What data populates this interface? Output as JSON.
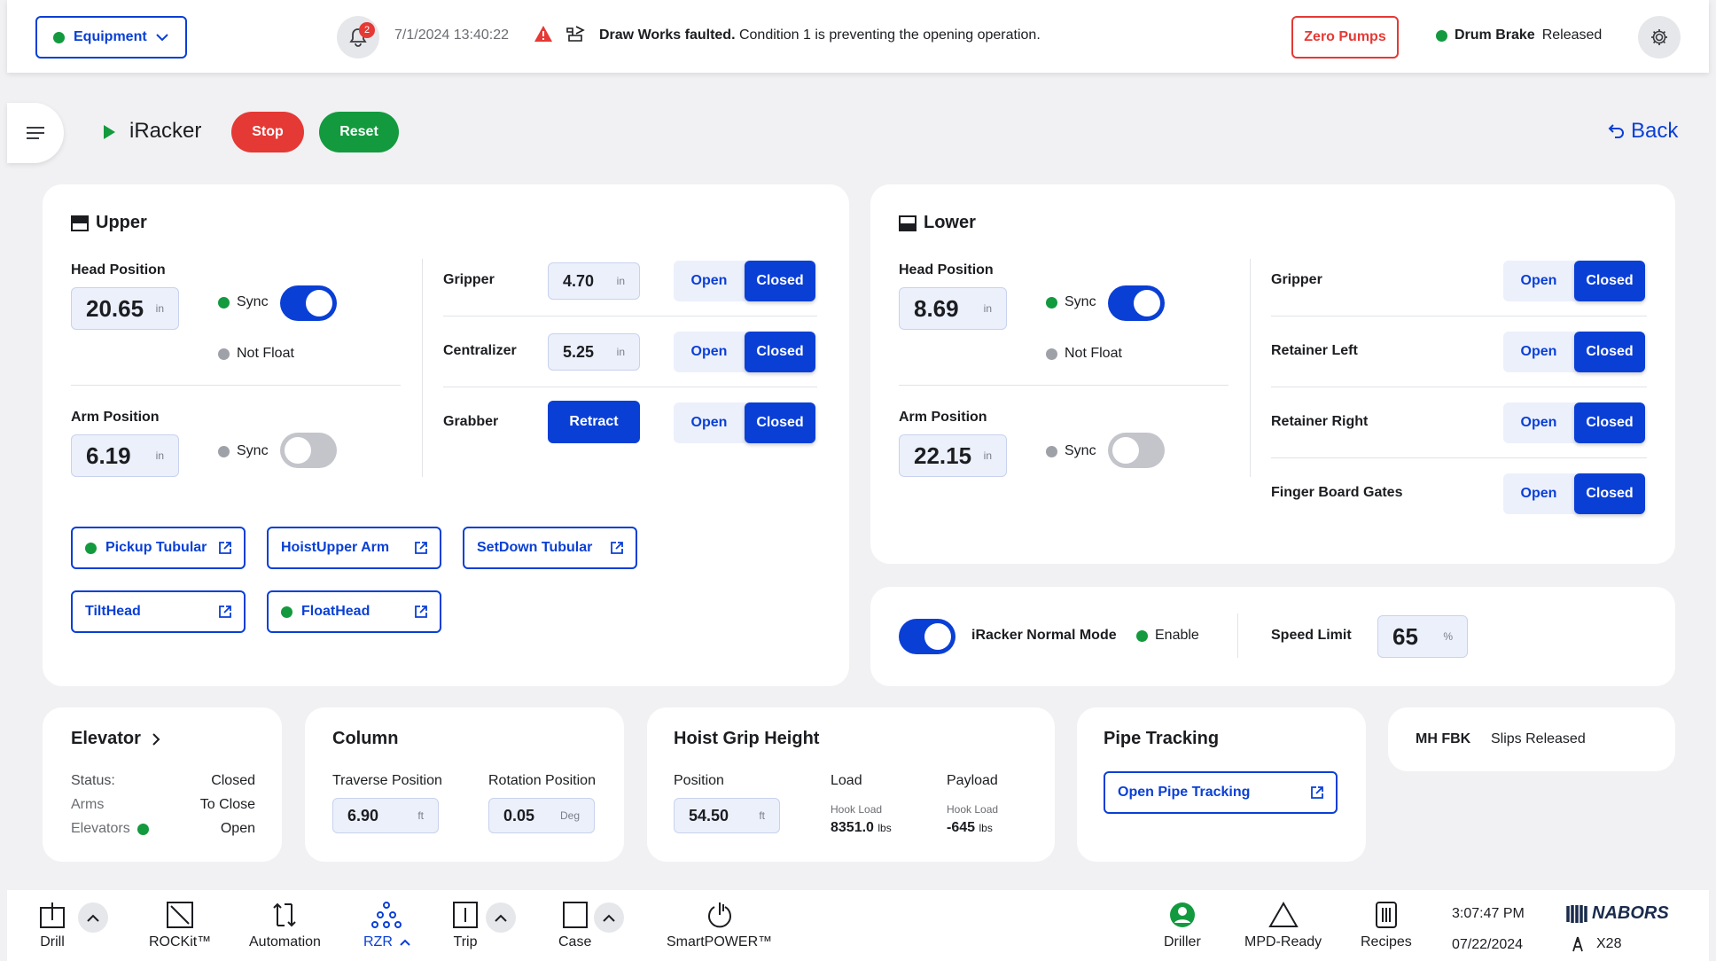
{
  "topbar": {
    "equipment_label": "Equipment",
    "notifications_count": "2",
    "timestamp": "7/1/2024  13:40:22",
    "fault_bold": "Draw Works faulted.",
    "fault_text": " Condition 1 is preventing the opening operation.",
    "zero_pumps_label": "Zero Pumps",
    "drum_brake_label": "Drum Brake",
    "drum_brake_value": "Released"
  },
  "header": {
    "app_title": "iRacker",
    "stop_label": "Stop",
    "reset_label": "Reset",
    "back_label": "Back"
  },
  "upper": {
    "title": "Upper",
    "head_position_label": "Head Position",
    "head_position_value": "20.65",
    "head_position_unit": "in",
    "head_sync_label": "Sync",
    "not_float_label": "Not Float",
    "arm_position_label": "Arm Position",
    "arm_position_value": "6.19",
    "arm_position_unit": "in",
    "arm_sync_label": "Sync",
    "gripper_label": "Gripper",
    "gripper_value": "4.70",
    "gripper_unit": "in",
    "centralizer_label": "Centralizer",
    "centralizer_value": "5.25",
    "centralizer_unit": "in",
    "grabber_label": "Grabber",
    "retract_label": "Retract",
    "open_label": "Open",
    "closed_label": "Closed",
    "buttons": {
      "pickup_tubular": "Pickup Tubular",
      "hoist_upper_arm": "HoistUpper Arm",
      "setdown_tubular": "SetDown Tubular",
      "tilt_head": "TiltHead",
      "float_head": "FloatHead"
    }
  },
  "lower": {
    "title": "Lower",
    "head_position_label": "Head Position",
    "head_position_value": "8.69",
    "head_position_unit": "in",
    "head_sync_label": "Sync",
    "not_float_label": "Not Float",
    "arm_position_label": "Arm Position",
    "arm_position_value": "22.15",
    "arm_position_unit": "in",
    "arm_sync_label": "Sync",
    "gripper_label": "Gripper",
    "retainer_left_label": "Retainer Left",
    "retainer_right_label": "Retainer Right",
    "finger_board_label": "Finger Board Gates",
    "open_label": "Open",
    "closed_label": "Closed"
  },
  "mode": {
    "normal_mode_label": "iRacker Normal Mode",
    "enable_label": "Enable",
    "speed_limit_label": "Speed Limit",
    "speed_limit_value": "65",
    "speed_limit_unit": "%"
  },
  "elevator": {
    "title": "Elevator",
    "status_label": "Status:",
    "status_value": "Closed",
    "arms_label": "Arms",
    "arms_value": "To Close",
    "elevators_label": "Elevators",
    "elevators_value": "Open"
  },
  "column": {
    "title": "Column",
    "traverse_label": "Traverse Position",
    "traverse_value": "6.90",
    "traverse_unit": "ft",
    "rotation_label": "Rotation Position",
    "rotation_value": "0.05",
    "rotation_unit": "Deg"
  },
  "hoist": {
    "title": "Hoist Grip Height",
    "position_label": "Position",
    "position_value": "54.50",
    "position_unit": "ft",
    "load_label": "Load",
    "hook_load_label": "Hook Load",
    "load_value": "8351.0",
    "load_unit": "lbs",
    "payload_label": "Payload",
    "payload_hook_label": "Hook Load",
    "payload_value": "-645",
    "payload_unit": "lbs"
  },
  "pipe_tracking": {
    "title": "Pipe Tracking",
    "open_button": "Open Pipe Tracking"
  },
  "mh": {
    "label": "MH FBK",
    "value": "Slips Released"
  },
  "taskbar": {
    "drill": "Drill",
    "rockit": "ROCKit™",
    "automation": "Automation",
    "rzr": "RZR",
    "trip": "Trip",
    "case": "Case",
    "smartpower": "SmartPOWER™",
    "driller": "Driller",
    "mpd_ready": "MPD-Ready",
    "recipes": "Recipes",
    "time": "3:07:47 PM",
    "date": "07/22/2024",
    "brand": "NABORS",
    "rig": "X28"
  },
  "colors": {
    "accent": "#0a3fd6",
    "danger": "#e53935",
    "success": "#139a3e"
  }
}
